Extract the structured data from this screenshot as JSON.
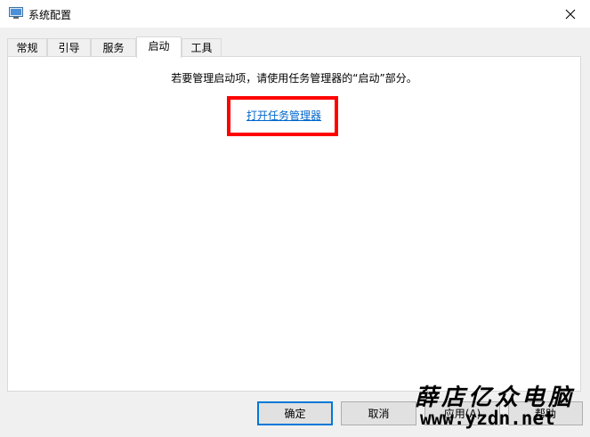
{
  "window": {
    "title": "系统配置",
    "close_icon": "close-icon"
  },
  "tabs": [
    {
      "label": "常规"
    },
    {
      "label": "引导"
    },
    {
      "label": "服务"
    },
    {
      "label": "启动",
      "active": true
    },
    {
      "label": "工具"
    }
  ],
  "startup": {
    "info_text": "若要管理启动项，请使用任务管理器的“启动”部分。",
    "link_text": "打开任务管理器",
    "highlight_color": "#ff0000"
  },
  "buttons": {
    "ok": "确定",
    "cancel": "取消",
    "apply": "应用(A)",
    "help": "帮助"
  },
  "watermark": {
    "chinese": "薛店亿众电脑",
    "url": "www.yzdn.net"
  }
}
